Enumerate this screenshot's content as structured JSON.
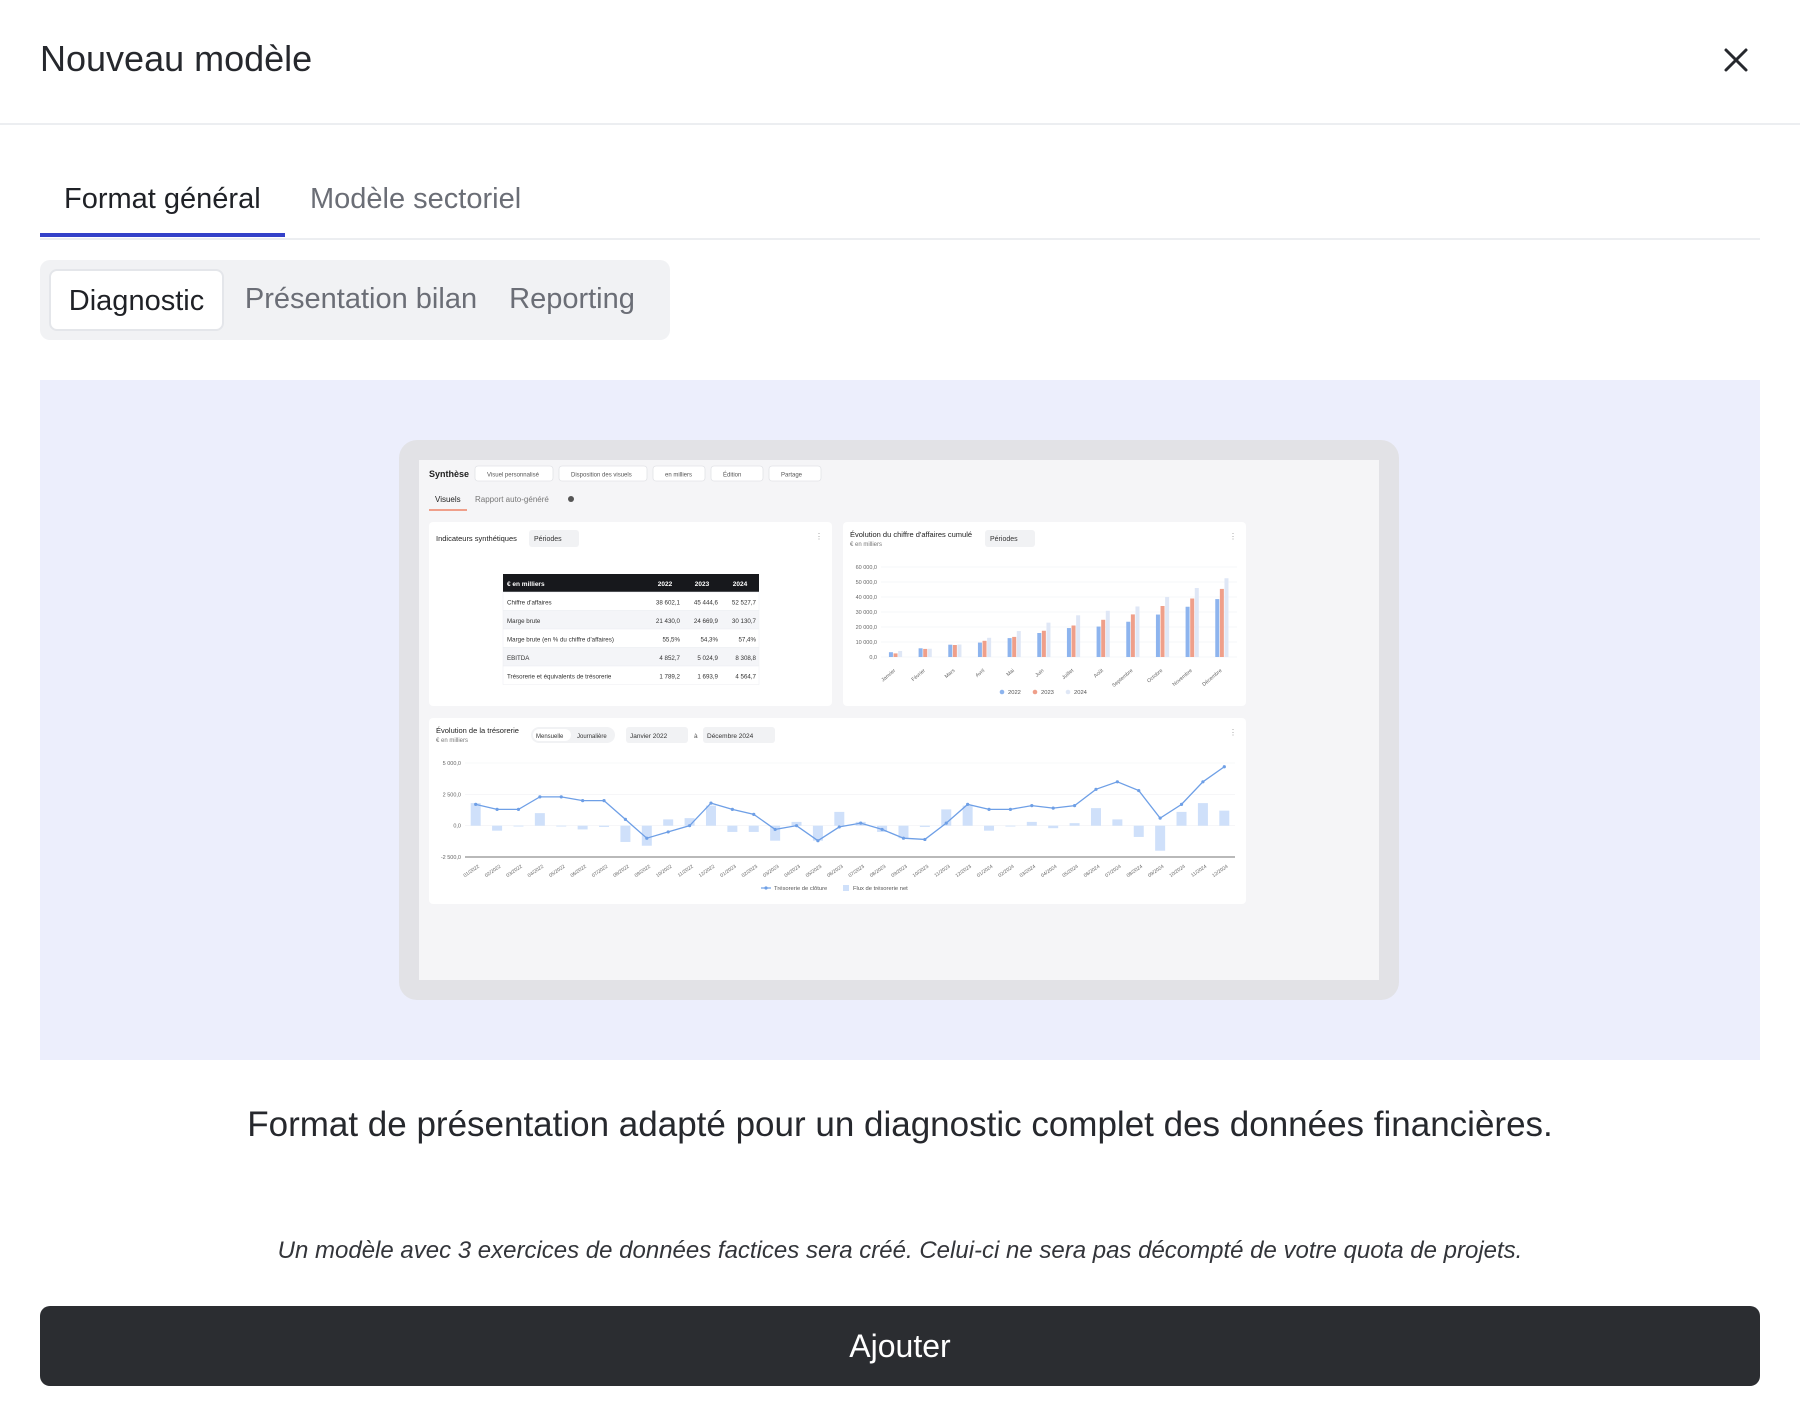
{
  "modal": {
    "title": "Nouveau modèle",
    "close_icon": "close-icon"
  },
  "tabs": [
    {
      "label": "Format général",
      "active": true
    },
    {
      "label": "Modèle sectoriel",
      "active": false
    }
  ],
  "segments": [
    {
      "label": "Diagnostic",
      "active": true
    },
    {
      "label": "Présentation bilan",
      "active": false
    },
    {
      "label": "Reporting",
      "active": false
    }
  ],
  "preview": {
    "toolbar": {
      "title": "Synthèse",
      "buttons": [
        "Visuel personnalisé",
        "Disposition des visuels",
        "en milliers",
        "Édition",
        "Partage"
      ]
    },
    "subtabs": [
      "Visuels",
      "Rapport auto-généré"
    ],
    "indicators_card": {
      "title": "Indicateurs synthétiques",
      "dropdown": "Périodes",
      "table": {
        "header": [
          "€ en milliers",
          "2022",
          "2023",
          "2024"
        ],
        "rows": [
          [
            "Chiffre d'affaires",
            "38 602,1",
            "45 444,6",
            "52 527,7"
          ],
          [
            "Marge brute",
            "21 430,0",
            "24 669,9",
            "30 130,7"
          ],
          [
            "Marge brute (en % du chiffre d'affaires)",
            "55,5%",
            "54,3%",
            "57,4%"
          ],
          [
            "EBITDA",
            "4 852,7",
            "5 024,9",
            "8 308,8"
          ],
          [
            "Trésorerie et équivalents de trésorerie",
            "1 789,2",
            "1 693,9",
            "4 564,7"
          ]
        ]
      }
    },
    "revenue_card": {
      "title": "Évolution du chiffre d'affaires cumulé",
      "subtitle": "€ en milliers",
      "dropdown": "Périodes"
    },
    "treasury_card": {
      "title": "Évolution de la trésorerie",
      "subtitle": "€ en milliers",
      "toggle": [
        "Mensuelle",
        "Journalière"
      ],
      "from": "Janvier 2022",
      "separator": "à",
      "to": "Décembre 2024"
    }
  },
  "chart_data": [
    {
      "type": "bar",
      "title": "Évolution du chiffre d'affaires cumulé",
      "ylabel": "€ en milliers",
      "categories": [
        "Janvier",
        "Février",
        "Mars",
        "Avril",
        "Mai",
        "Juin",
        "Juillet",
        "Août",
        "Septembre",
        "Octobre",
        "Novembre",
        "Décembre"
      ],
      "ylim": [
        0,
        60000
      ],
      "yticks": [
        "60 000,0",
        "50 000,0",
        "40 000,0",
        "30 000,0",
        "20 000,0",
        "10 000,0",
        "0,0"
      ],
      "series": [
        {
          "name": "2022",
          "color": "#8db4ee",
          "values": [
            3200,
            5800,
            8200,
            9600,
            12600,
            16000,
            19300,
            20300,
            23500,
            28300,
            33500,
            38600
          ]
        },
        {
          "name": "2023",
          "color": "#ef9f8a",
          "values": [
            2400,
            5400,
            8000,
            10800,
            13400,
            17500,
            21000,
            24800,
            28400,
            34000,
            39000,
            45400
          ]
        },
        {
          "name": "2024",
          "color": "#dfe7f6",
          "values": [
            4000,
            5500,
            8300,
            12800,
            17300,
            22900,
            27800,
            30800,
            33700,
            40000,
            46000,
            52500
          ]
        }
      ]
    },
    {
      "type": "line",
      "title": "Évolution de la trésorerie",
      "ylabel": "€ en milliers",
      "ylim": [
        -2500,
        5000
      ],
      "yticks": [
        "5 000,0",
        "2 500,0",
        "0,0",
        "-2 500,0"
      ],
      "x": [
        "01/2022",
        "02/2022",
        "03/2022",
        "04/2022",
        "05/2022",
        "06/2022",
        "07/2022",
        "08/2022",
        "09/2022",
        "10/2022",
        "11/2022",
        "12/2022",
        "01/2023",
        "02/2023",
        "03/2023",
        "04/2023",
        "05/2023",
        "06/2023",
        "07/2023",
        "08/2023",
        "09/2023",
        "10/2023",
        "11/2023",
        "12/2023",
        "01/2024",
        "02/2024",
        "03/2024",
        "04/2024",
        "05/2024",
        "06/2024",
        "07/2024",
        "08/2024",
        "09/2024",
        "10/2024",
        "11/2024",
        "12/2024"
      ],
      "series": [
        {
          "name": "Trésorerie de clôture",
          "color": "#6e9fe6",
          "values": [
            1700,
            1300,
            1300,
            2300,
            2300,
            2000,
            2000,
            500,
            -1000,
            -500,
            0,
            1800,
            1300,
            900,
            -300,
            0,
            -1200,
            -100,
            200,
            -300,
            -1000,
            -1100,
            200,
            1700,
            1300,
            1300,
            1600,
            1400,
            1600,
            2900,
            3500,
            2800,
            600,
            1700,
            3500,
            4700
          ]
        },
        {
          "name": "Flux de trésorerie net",
          "color": "#cfe0fa",
          "values": [
            1800,
            -400,
            0,
            1000,
            0,
            -300,
            -100,
            -1300,
            -1600,
            500,
            600,
            1600,
            -500,
            -500,
            -1200,
            300,
            -1200,
            1100,
            300,
            -500,
            -1000,
            -100,
            1300,
            1600,
            -400,
            0,
            300,
            -200,
            200,
            1400,
            500,
            -900,
            -2000,
            1100,
            1800,
            1200
          ]
        }
      ]
    }
  ],
  "description": "Format de présentation adapté pour un diagnostic complet des données financières.",
  "note": "Un modèle avec 3 exercices de données factices sera créé. Celui-ci ne sera pas décompté de votre quota de projets.",
  "submit_label": "Ajouter"
}
